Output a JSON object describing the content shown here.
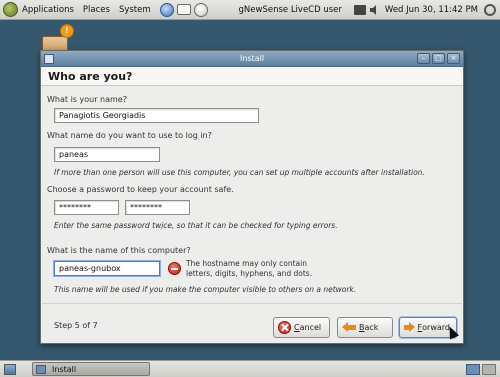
{
  "top_panel": {
    "menus": [
      "Applications",
      "Places",
      "System"
    ],
    "user": "gNewSense LiveCD user",
    "clock": "Wed Jun 30, 11:42 PM"
  },
  "window": {
    "title": "Install",
    "heading": "Who are you?"
  },
  "form": {
    "name_label": "What is your name?",
    "name_value": "Panagiotis Georgiadis",
    "login_label": "What name do you want to use to log in?",
    "login_value": "paneas",
    "login_hint": "If more than one person will use this computer, you can set up multiple accounts after installation.",
    "password_label": "Choose a password to keep your account safe.",
    "password_value": "********",
    "password_confirm_value": "********",
    "password_hint": "Enter the same password twice, so that it can be checked for typing errors.",
    "computer_label": "What is the name of this computer?",
    "computer_value": "paneas-gnubox",
    "computer_warning_line1": "The hostname may only contain",
    "computer_warning_line2": "letters, digits, hyphens, and dots.",
    "computer_hint": "This name will be used if you make the computer visible to others on a network."
  },
  "footer": {
    "step": "Step 5 of 7",
    "cancel_first": "C",
    "cancel_rest": "ancel",
    "back_first": "B",
    "back_rest": "ack",
    "forward_first": "F",
    "forward_rest": "orward"
  },
  "bottom_panel": {
    "task": "Install"
  }
}
